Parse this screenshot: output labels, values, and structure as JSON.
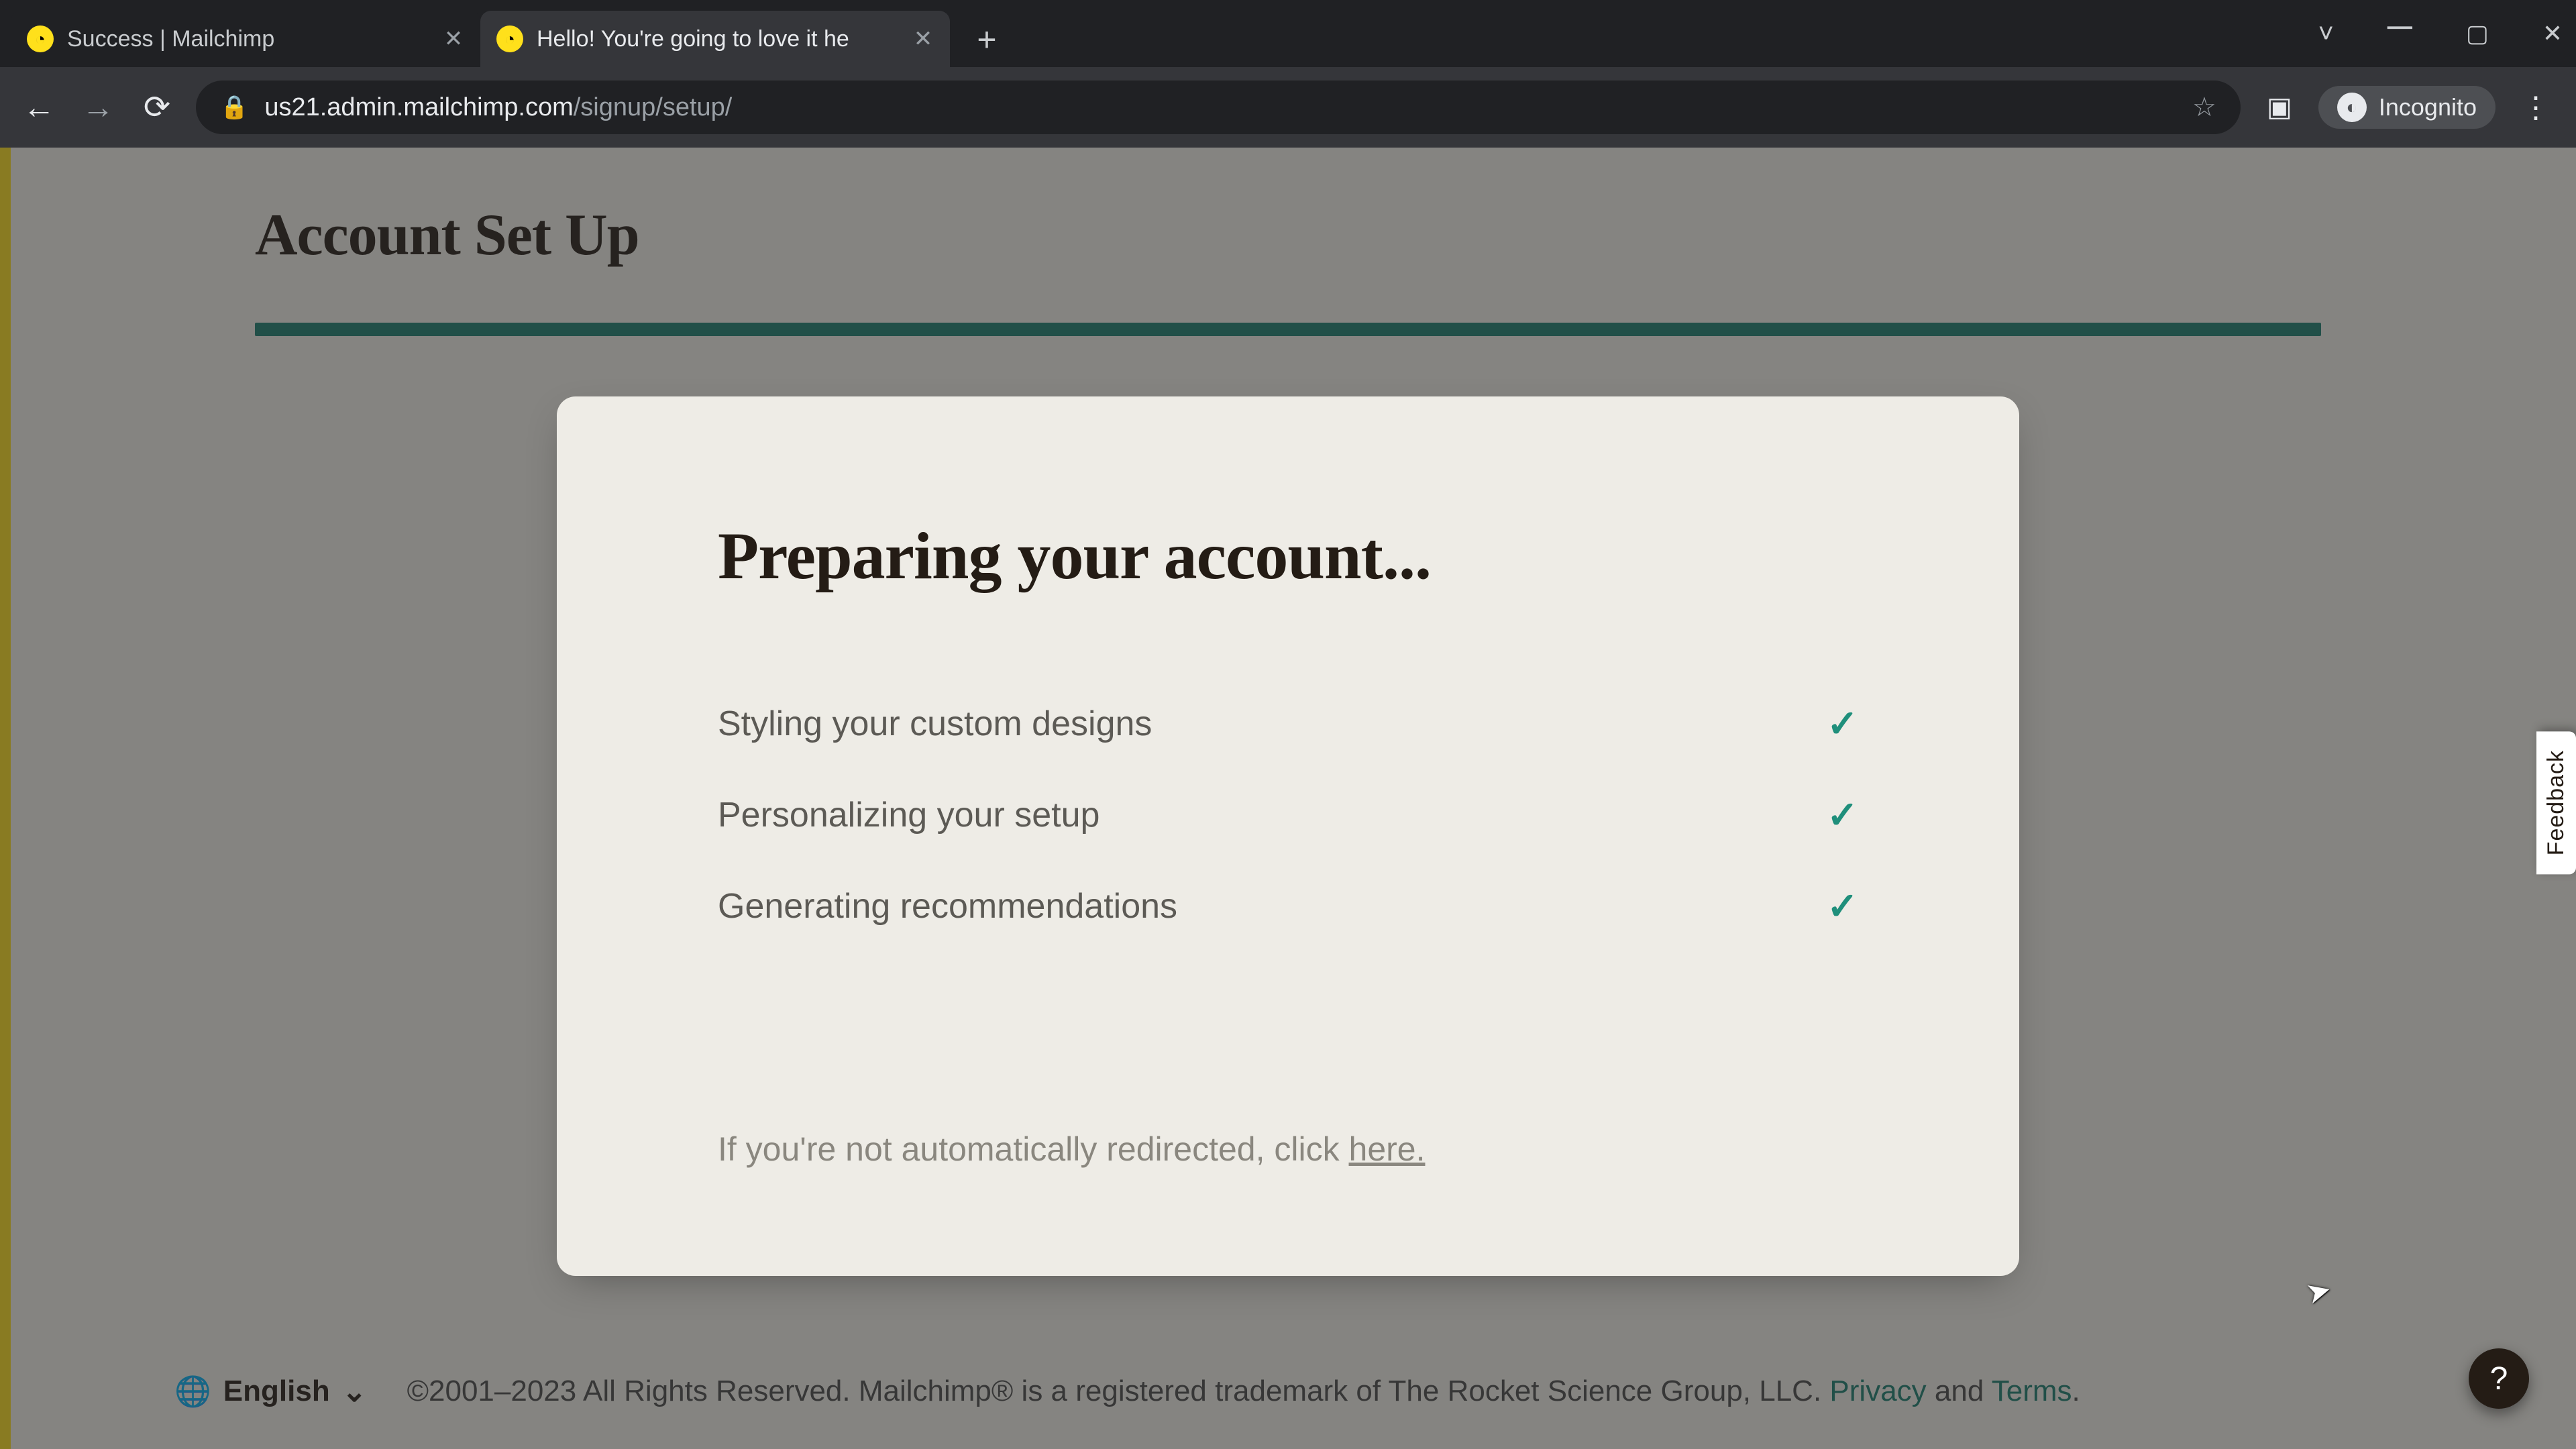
{
  "browser": {
    "tabs": [
      {
        "title": "Success | Mailchimp",
        "active": false
      },
      {
        "title": "Hello! You're going to love it he",
        "active": true
      }
    ],
    "url_host": "us21.admin.mailchimp.com",
    "url_path": "/signup/setup/",
    "incognito_label": "Incognito"
  },
  "page": {
    "title": "Account Set Up",
    "progress_pct": 100,
    "card": {
      "heading": "Preparing your account...",
      "steps": [
        {
          "label": "Styling your custom designs",
          "done": true
        },
        {
          "label": "Personalizing your setup",
          "done": true
        },
        {
          "label": "Generating recommendations",
          "done": true
        }
      ],
      "redirect_prefix": "If you're not automatically redirected, click ",
      "redirect_link": "here."
    }
  },
  "footer": {
    "language": "English",
    "copyright": "©2001–2023 All Rights Reserved. Mailchimp® is a registered trademark of The Rocket Science Group, LLC. ",
    "privacy": "Privacy",
    "and": " and ",
    "terms": "Terms",
    "period": "."
  },
  "feedback_label": "Feedback",
  "help_label": "?"
}
